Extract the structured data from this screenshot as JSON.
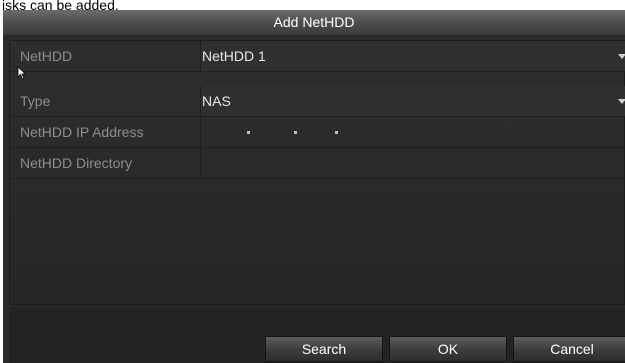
{
  "page_caption": "isks can be added.",
  "dialog": {
    "title": "Add NetHDD",
    "fields": [
      {
        "label": "NetHDD",
        "value": "NetHDD 1",
        "dropdown": true
      },
      {
        "label": "Type",
        "value": "NAS",
        "dropdown": true
      },
      {
        "label": "NetHDD IP Address",
        "value": ". . ."
      },
      {
        "label": "NetHDD Directory",
        "value": ""
      }
    ],
    "buttons": {
      "search": "Search",
      "ok": "OK",
      "cancel": "Cancel"
    }
  },
  "colors": {
    "dialog_bg": "#2b2b2b",
    "title_bar": "#4e4e4e",
    "label_text": "#8e8e8e",
    "value_text": "#e8e8e8"
  },
  "icons": [
    "mouse-pointer-icon",
    "chevron-down-icon"
  ]
}
